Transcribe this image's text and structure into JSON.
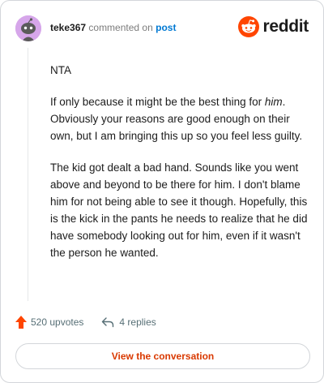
{
  "header": {
    "username": "teke367",
    "action": "commented on",
    "link": "post",
    "logo_text": "reddit"
  },
  "comment": {
    "paragraphs": [
      {
        "text": "NTA"
      },
      {
        "before": "If only because it might be the best thing for ",
        "em": "him",
        "after": ". Obviously your reasons are good enough on their own, but I am bringing this up so you feel less guilty."
      },
      {
        "text": "The kid got dealt a bad hand. Sounds like you went above and beyond to be there for him. I don't blame him for not being able to see it though. Hopefully, this is the kick in the pants he needs to realize that he did have somebody looking out for him, even if it wasn't the person he wanted."
      }
    ]
  },
  "footer": {
    "upvotes": "520 upvotes",
    "replies": "4 replies"
  },
  "cta_label": "View the conversation",
  "colors": {
    "reddit_orange": "#ff4500",
    "link_blue": "#0079d3",
    "cta_text": "#d93900",
    "avatar_bg": "#d6a6ea"
  },
  "icons": [
    "snoo-avatar-icon",
    "reddit-logo-icon",
    "upvote-arrow-icon",
    "reply-icon"
  ]
}
